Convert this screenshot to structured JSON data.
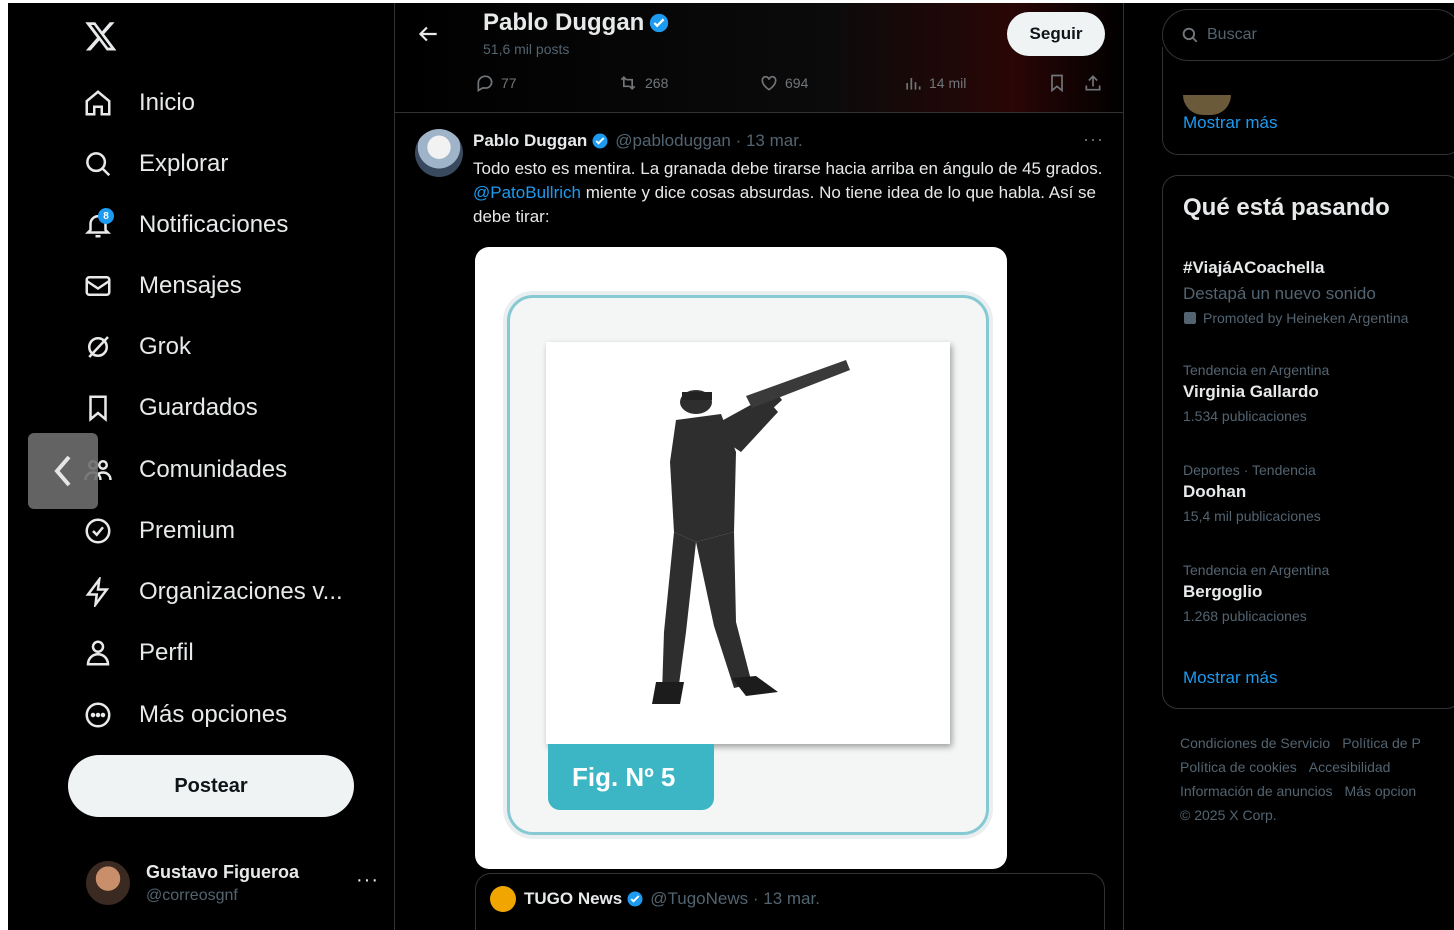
{
  "sidebar": {
    "nav": [
      {
        "label": "Inicio",
        "icon": "home-icon"
      },
      {
        "label": "Explorar",
        "icon": "search-icon"
      },
      {
        "label": "Notificaciones",
        "icon": "bell-icon"
      },
      {
        "label": "Mensajes",
        "icon": "mail-icon"
      },
      {
        "label": "Grok",
        "icon": "grok-icon"
      },
      {
        "label": "Guardados",
        "icon": "bookmark-icon"
      },
      {
        "label": "Comunidades",
        "icon": "communities-icon"
      },
      {
        "label": "Premium",
        "icon": "premium-icon"
      },
      {
        "label": "Organizaciones v...",
        "icon": "lightning-icon"
      },
      {
        "label": "Perfil",
        "icon": "person-icon"
      },
      {
        "label": "Más opciones",
        "icon": "more-circle-icon"
      }
    ],
    "notification_badge": "8",
    "post_label": "Postear",
    "user": {
      "name": "Gustavo Figueroa",
      "handle": "@correosgnf",
      "more": "···"
    }
  },
  "header": {
    "title": "Pablo Duggan",
    "posts": "51,6 mil posts",
    "follow_label": "Seguir",
    "actions": {
      "replies": "77",
      "reposts": "268",
      "likes": "694",
      "views": "14 mil"
    }
  },
  "tweet": {
    "author": "Pablo Duggan",
    "handle_date": "@pabloduggan · 13 mar.",
    "more": "···",
    "text_before": "Todo esto es mentira. La granada debe tirarse hacia arriba en ángulo de 45 grados. ",
    "mention": "@PatoBullrich",
    "text_after": " miente y dice cosas absurdas. No tiene idea de lo que habla. Así se debe tirar:",
    "figure_label": "Fig. Nº 5",
    "quoted": {
      "name": "TUGO News",
      "handle_date": "@TugoNews · 13 mar."
    }
  },
  "right": {
    "search_placeholder": "Buscar",
    "show_more": "Mostrar más",
    "trends_title": "Qué está pasando",
    "promoted": {
      "name": "#ViajáACoachella",
      "desc": "Destapá un nuevo sonido",
      "promoter": "Promoted by Heineken Argentina"
    },
    "trends": [
      {
        "context": "Tendencia en Argentina",
        "name": "Virginia Gallardo",
        "count": "1.534 publicaciones"
      },
      {
        "context": "Deportes · Tendencia",
        "name": "Doohan",
        "count": "15,4 mil publicaciones"
      },
      {
        "context": "Tendencia en Argentina",
        "name": "Bergoglio",
        "count": "1.268 publicaciones"
      }
    ],
    "show_more_2": "Mostrar más",
    "footer": [
      "Condiciones de Servicio",
      "Política de P",
      "Política de cookies",
      "Accesibilidad",
      "Información de anuncios",
      "Más opcion",
      "© 2025 X Corp."
    ]
  },
  "colors": {
    "accent": "#1d9bf0",
    "background": "#000000",
    "muted": "#536471",
    "figure_teal": "#3cb5c4"
  }
}
